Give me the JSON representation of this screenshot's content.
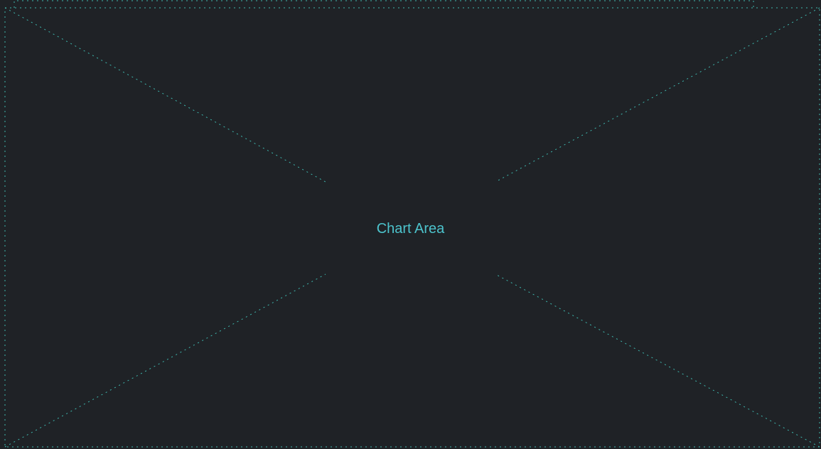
{
  "placeholder": {
    "label": "Chart Area",
    "accent_color": "#3fb8af",
    "background_color": "#1f2226"
  }
}
